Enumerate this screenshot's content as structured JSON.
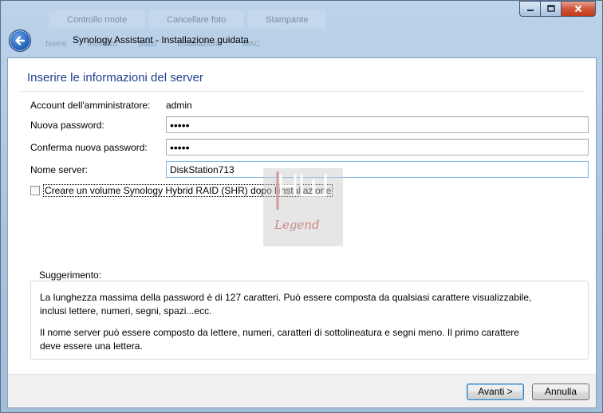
{
  "window": {
    "title": "Synology Assistant - Installazione guidata",
    "background_tabs": [
      "Controllo rmote",
      "Cancellare foto",
      "Stampante"
    ],
    "background_row": [
      "Nome",
      "Indirizzo",
      "Stato",
      "Installazione",
      "MAC"
    ]
  },
  "form": {
    "heading": "Inserire le informazioni del server",
    "admin_label": "Account dell'amministratore:",
    "admin_value": "admin",
    "password_label": "Nuova password:",
    "password_value": "•••••",
    "confirm_label": "Conferma nuova password:",
    "confirm_value": "•••••",
    "server_label": "Nome server:",
    "server_value": "DiskStation713",
    "shr_checkbox_label": "Creare un volume Synology Hybrid RAID (SHR) dopo l'installazione",
    "shr_checked": false
  },
  "hint": {
    "title": "Suggerimento:",
    "paragraph1_line1": "La lunghezza massima della password è di 127 caratteri. Può essere composta da qualsiasi carattere visualizzabile,",
    "paragraph1_line2": "inclusi lettere, numeri, segni, spazi...ecc.",
    "paragraph2_line1": "Il nome server può essere composto da lettere, numeri, caratteri di sottolineatura e segni meno. Il primo carattere",
    "paragraph2_line2": "deve essere una lettera."
  },
  "buttons": {
    "next": "Avanti >",
    "cancel": "Annulla"
  },
  "watermark": {
    "text": "Legend"
  },
  "colors": {
    "heading": "#1e3f8f",
    "close_button": "#c13a1b",
    "frame": "#a8c2de"
  }
}
